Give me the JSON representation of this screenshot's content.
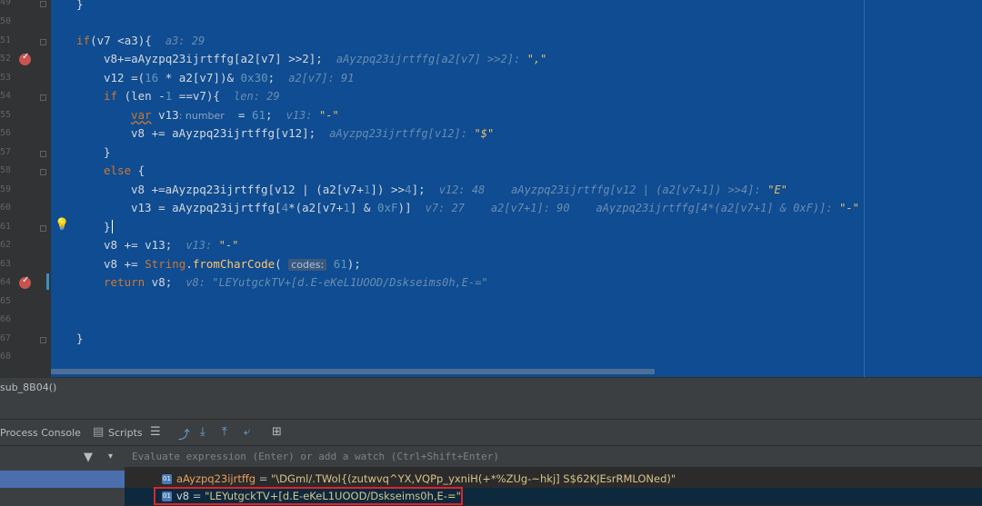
{
  "gutter": {
    "line_numbers": [
      "49",
      "50",
      "51",
      "52",
      "53",
      "54",
      "55",
      "56",
      "57",
      "58",
      "59",
      "60",
      "61",
      "62",
      "63",
      "64",
      "65",
      "66",
      "67",
      "68"
    ]
  },
  "code": {
    "l49": "}",
    "l51_kw": "if",
    "l51_code": "(v7 <a3){",
    "l51_hint": "a3: 29",
    "l52_code": "v8+=aAyzpq23ijrtffg[a2[v7] >>2];",
    "l52_hint": "aAyzpq23ijrtffg[a2[v7] >>2]:",
    "l52_val": "\",\"",
    "l53_a": "v12 =(",
    "l53_n1": "16",
    "l53_b": " * a2[v7])& ",
    "l53_n2": "0x30",
    "l53_c": ";",
    "l53_hint": "a2[v7]: 91",
    "l54_kw": "if",
    "l54_a": " (len -",
    "l54_n": "1",
    "l54_b": " ==v7){",
    "l54_hint": "len: 29",
    "l55_kw": "var",
    "l55_a": " v13",
    "l55_inlay": ": number",
    "l55_b": "  = ",
    "l55_n": "61",
    "l55_c": ";",
    "l55_hint": "v13:",
    "l55_val": "\"-\"",
    "l56_code": "v8 += aAyzpq23ijrtffg[v12];",
    "l56_hint": "aAyzpq23ijrtffg[v12]:",
    "l56_val": "\"$\"",
    "l57": "}",
    "l58_kw": "else",
    "l58_b": " {",
    "l59_code": "v8 +=aAyzpq23ijrtffg[v12 | (a2[v7+",
    "l59_n": "1",
    "l59_code2": "]) >>",
    "l59_n2": "4",
    "l59_code3": "];",
    "l59_hint": "v12: 48    aAyzpq23ijrtffg[v12 | (a2[v7+1]) >>4]:",
    "l59_val": "\"E\"",
    "l60_a": "v13 = aAyzpq23ijrtffg[",
    "l60_n1": "4",
    "l60_b": "*(a2[v7+",
    "l60_n2": "1",
    "l60_c": "] & ",
    "l60_n3": "0xF",
    "l60_d": ")]",
    "l60_hint": "v7: 27    a2[v7+1]: 90    aAyzpq23ijrtffg[4*(a2[v7+1] & 0xF)]:",
    "l60_val": "\"-\"",
    "l61": "}",
    "l62_code": "v8 += v13;",
    "l62_hint": "v13:",
    "l62_val": "\"-\"",
    "l63_a": "v8 += ",
    "l63_obj": "String",
    "l63_dot": ".",
    "l63_fn": "fromCharCode",
    "l63_b": "(",
    "l63_inlay": "codes:",
    "l63_n": "61",
    "l63_c": ");",
    "l64_kw": "return",
    "l64_code": " v8;",
    "l64_hint": "v8: \"LEYutgckTV+[d.E-eKeL1UOOD/Dskseims0h,E-=\"",
    "l67": "}"
  },
  "breadcrumb": {
    "text": "sub_8B04()"
  },
  "debugger": {
    "tab_console": "Process Console",
    "tab_scripts": "Scripts",
    "eval_placeholder": "Evaluate expression (Enter) or add a watch (Ctrl+Shift+Enter)"
  },
  "watches": [
    {
      "name": "aAyzpq23ijrtffg",
      "eq": " = ",
      "value": "\"\\DGml/.TWol{(zutwvq^YX,VQPp_yxniH(+*%ZUg-~hkj] S$62KJEsrRMLONed)\""
    },
    {
      "name": "v8",
      "eq": " = ",
      "value": "\"LEYutgckTV+[d.E-eKeL1UOOD/Dskseims0h,E-=\""
    }
  ],
  "colors": {
    "editor_bg": "#0f4c91",
    "keyword": "#cc7832",
    "number": "#6897bb",
    "highlight_border": "#e0242a"
  }
}
